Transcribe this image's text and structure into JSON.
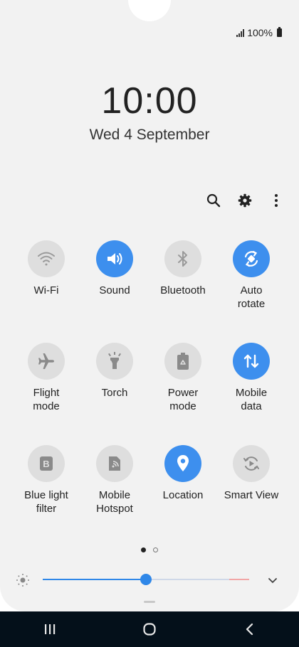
{
  "status": {
    "battery": "100%",
    "signal_level": 4
  },
  "lock": {
    "time": "10:00",
    "date": "Wed 4 September"
  },
  "toolbar": {
    "icons": [
      "search-icon",
      "gear-icon",
      "more-vert-icon"
    ]
  },
  "tiles": [
    {
      "label": "Wi-Fi",
      "icon": "wifi-icon",
      "on": false
    },
    {
      "label": "Sound",
      "icon": "sound-icon",
      "on": true
    },
    {
      "label": "Bluetooth",
      "icon": "bluetooth-icon",
      "on": false
    },
    {
      "label": "Auto\nrotate",
      "icon": "auto-rotate-icon",
      "on": true
    },
    {
      "label": "Flight\nmode",
      "icon": "airplane-icon",
      "on": false
    },
    {
      "label": "Torch",
      "icon": "torch-icon",
      "on": false
    },
    {
      "label": "Power\nmode",
      "icon": "battery-recycle-icon",
      "on": false
    },
    {
      "label": "Mobile\ndata",
      "icon": "mobile-data-icon",
      "on": true
    },
    {
      "label": "Blue light\nfilter",
      "icon": "blue-light-filter-icon",
      "on": false
    },
    {
      "label": "Mobile\nHotspot",
      "icon": "hotspot-icon",
      "on": false
    },
    {
      "label": "Location",
      "icon": "location-pin-icon",
      "on": true
    },
    {
      "label": "Smart View",
      "icon": "smart-view-icon",
      "on": false
    }
  ],
  "pager": {
    "page": 1,
    "pages": 2
  },
  "brightness": {
    "level": 0.5
  },
  "colors": {
    "accent": "#3d8fee",
    "tile_off": "#dedede",
    "panel_bg": "#f2f2f2",
    "navbar_bg": "#04101a"
  },
  "navbar": {
    "icons": [
      "recent-apps-icon",
      "home-icon",
      "back-icon"
    ]
  }
}
